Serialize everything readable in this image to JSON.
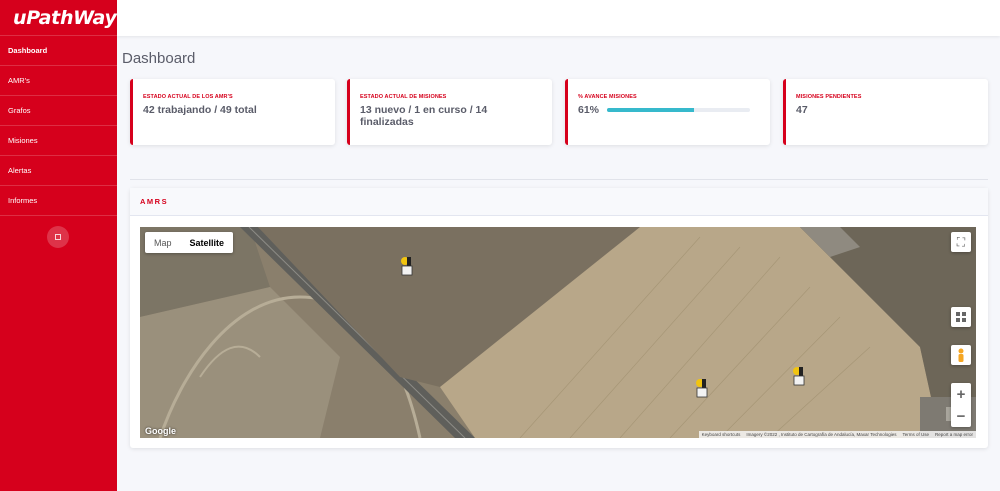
{
  "brand": "uPathWay",
  "nav": [
    {
      "label": "Dashboard",
      "active": true
    },
    {
      "label": "AMR's"
    },
    {
      "label": "Grafos"
    },
    {
      "label": "Misiones"
    },
    {
      "label": "Alertas"
    },
    {
      "label": "Informes"
    }
  ],
  "page_title": "Dashboard",
  "cards": {
    "amrs": {
      "label": "ESTADO ACTUAL DE LOS AMR'S",
      "value": "42 trabajando / 49 total"
    },
    "missions": {
      "label": "ESTADO ACTUAL DE MISIONES",
      "value": "13 nuevo / 1 en curso / 14 finalizadas"
    },
    "progress": {
      "label": "% AVANCE MISIONES",
      "value": "61%",
      "fraction": 0.61
    },
    "pending": {
      "label": "MISIONES PENDIENTES",
      "value": "47"
    }
  },
  "panel": {
    "title": "AMRS"
  },
  "map": {
    "type_map": "Map",
    "type_satellite": "Satellite",
    "selected_type": "Satellite",
    "google": "Google",
    "attribution": {
      "shortcuts": "Keyboard shortcuts",
      "imagery": "Imagery ©2022 , Instituto de Cartografía de Andalucía, Maxar Technologies",
      "terms": "Terms of Use",
      "report": "Report a map error"
    },
    "zoom_in": "+",
    "zoom_out": "−"
  },
  "colors": {
    "brand": "#d6001c",
    "progress": "#36b9cc"
  }
}
